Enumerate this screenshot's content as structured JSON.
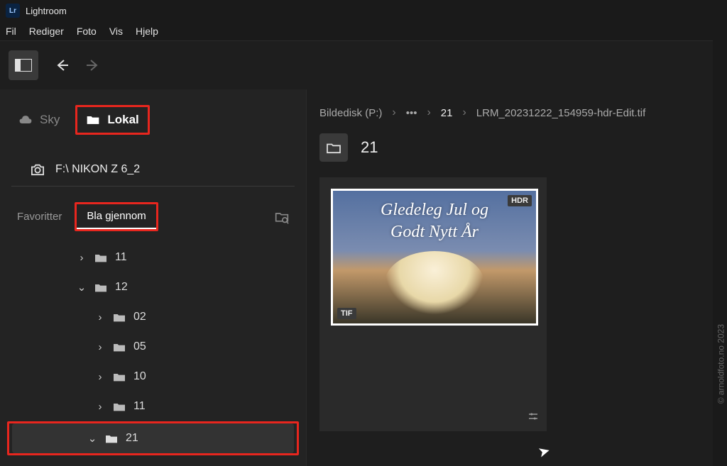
{
  "app": {
    "name": "Lightroom",
    "logo_text": "Lr"
  },
  "menu": {
    "file": "Fil",
    "edit": "Rediger",
    "photo": "Foto",
    "view": "Vis",
    "help": "Hjelp"
  },
  "sources": {
    "cloud": "Sky",
    "local": "Lokal"
  },
  "device": {
    "path": "F:\\ NIKON Z 6_2"
  },
  "subtabs": {
    "favorites": "Favoritter",
    "browse": "Bla gjennom"
  },
  "tree": {
    "items": [
      {
        "label": "11",
        "expanded": false,
        "depth": 1
      },
      {
        "label": "12",
        "expanded": true,
        "depth": 1
      },
      {
        "label": "02",
        "expanded": false,
        "depth": 2
      },
      {
        "label": "05",
        "expanded": false,
        "depth": 2
      },
      {
        "label": "10",
        "expanded": false,
        "depth": 2
      },
      {
        "label": "11",
        "expanded": false,
        "depth": 2
      },
      {
        "label": "21",
        "expanded": true,
        "depth": 2,
        "selected": true
      }
    ]
  },
  "breadcrumb": {
    "root": "Bildedisk (P:)",
    "ellipsis": "•••",
    "folder": "21",
    "file": "LRM_20231222_154959-hdr-Edit.tif"
  },
  "folder_view": {
    "title": "21"
  },
  "thumbnail": {
    "overlay_line1": "Gledeleg Jul  og",
    "overlay_line2": "Godt Nytt År",
    "badge_hdr": "HDR",
    "badge_format": "TIF"
  },
  "credit": "© arnoldfoto.no 2023"
}
